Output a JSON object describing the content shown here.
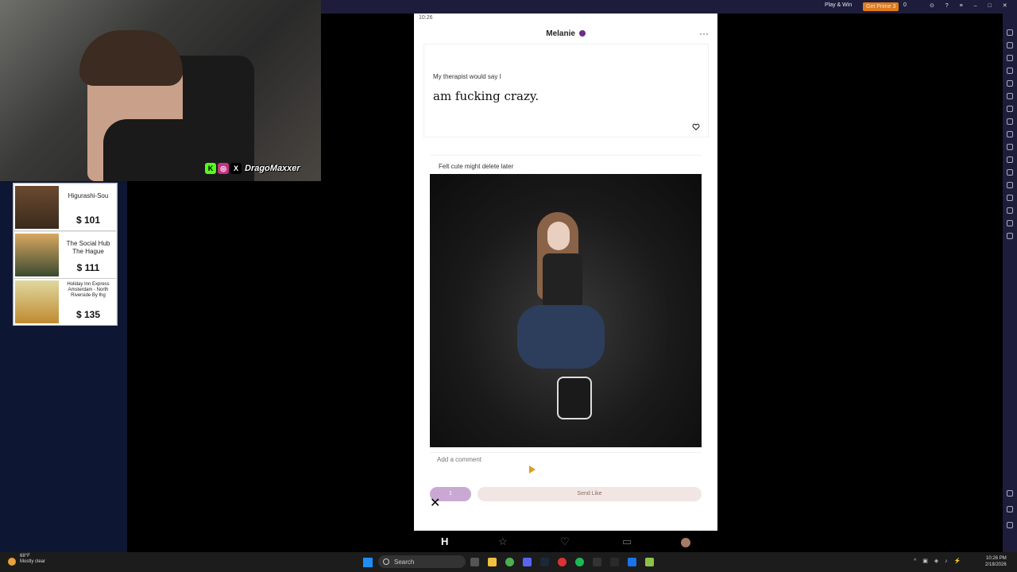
{
  "emulator": {
    "play_win": "Play & Win",
    "get_primes": "Get Prime 3",
    "coins": "0"
  },
  "stream": {
    "handle": "DragoMaxxer"
  },
  "ads": [
    {
      "name": "Higurashi-Sou",
      "price": "$ 101"
    },
    {
      "name": "The Social Hub The Hague",
      "price": "$ 111"
    },
    {
      "name": "Holiday Inn Express Amsterdam - North Riverside By Ihg",
      "price": "$ 135"
    }
  ],
  "phone": {
    "status_time": "10:26",
    "profile_name": "Melanie",
    "prompt_question": "My therapist would say I",
    "prompt_answer": "am fucking crazy.",
    "photo_caption": "Felt cute might delete later",
    "comment_placeholder": "Add a comment",
    "like_count": "1",
    "send_like": "Send Like"
  },
  "taskbar": {
    "weather_temp": "68°F",
    "weather_desc": "Mostly clear",
    "search": "Search",
    "clock_time": "10:26 PM",
    "clock_date": "2/18/2026"
  }
}
